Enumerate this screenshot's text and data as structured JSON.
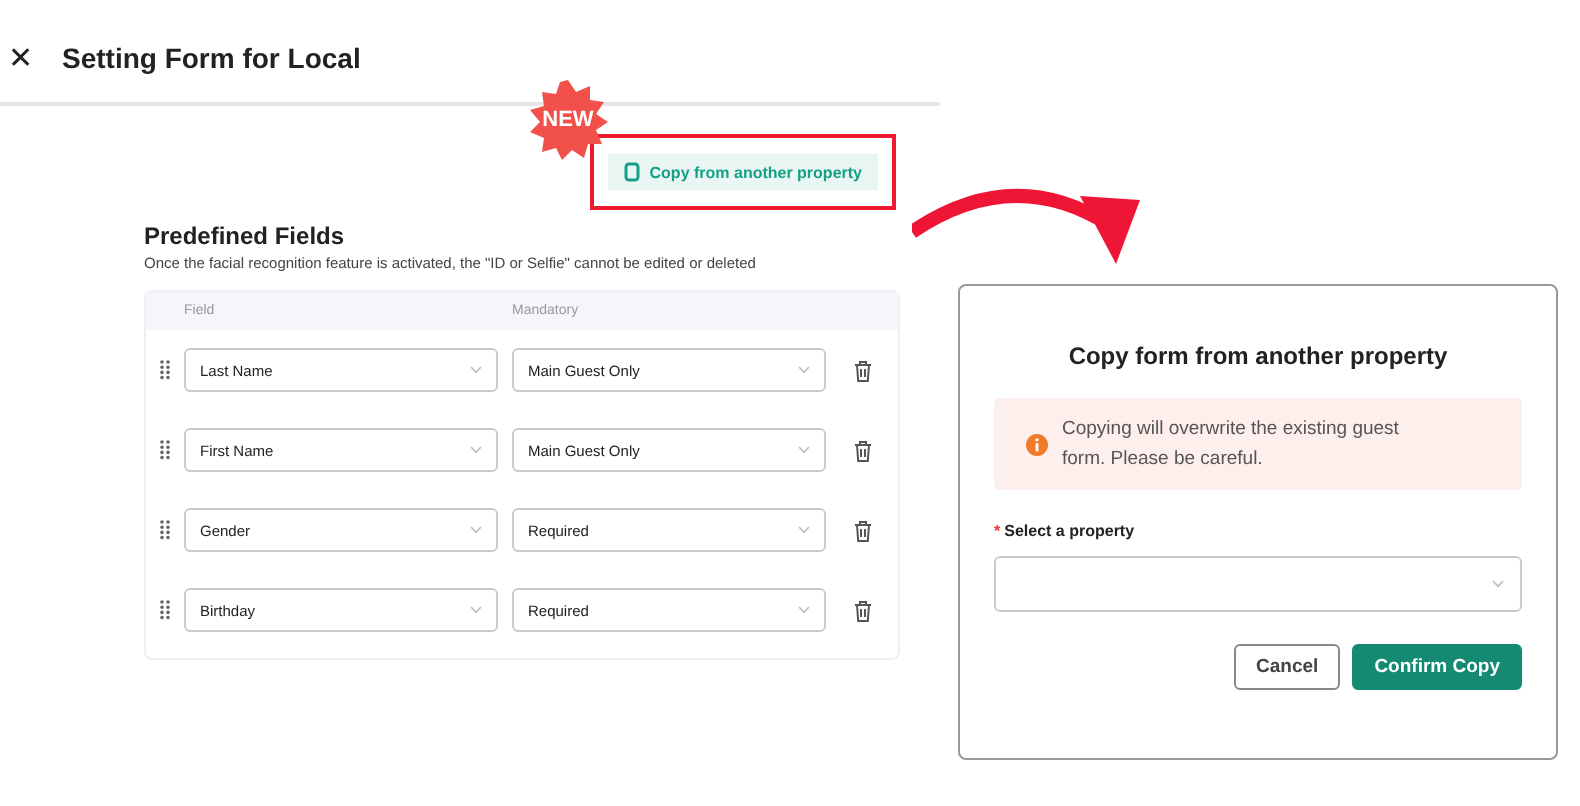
{
  "header": {
    "close_icon": "✕",
    "title": "Setting Form for Local"
  },
  "badge": {
    "label": "NEW"
  },
  "copy_button": {
    "label": "Copy from another property",
    "highlighted": true
  },
  "section": {
    "title": "Predefined Fields",
    "note": "Once the facial recognition feature is activated, the \"ID or Selfie\" cannot be edited or deleted"
  },
  "table": {
    "columns": [
      "Field",
      "Mandatory"
    ],
    "rows": [
      {
        "field": "Last Name",
        "mandatory": "Main Guest Only"
      },
      {
        "field": "First Name",
        "mandatory": "Main Guest Only"
      },
      {
        "field": "Gender",
        "mandatory": "Required"
      },
      {
        "field": "Birthday",
        "mandatory": "Required"
      }
    ]
  },
  "dialog": {
    "title": "Copy form from another property",
    "warning": "Copying will overwrite the existing guest form. Please be careful.",
    "field_label": "Select a property",
    "required_mark": "*",
    "buttons": [
      {
        "label": "Cancel",
        "kind": "secondary"
      },
      {
        "label": "Confirm Copy",
        "kind": "primary"
      }
    ]
  }
}
